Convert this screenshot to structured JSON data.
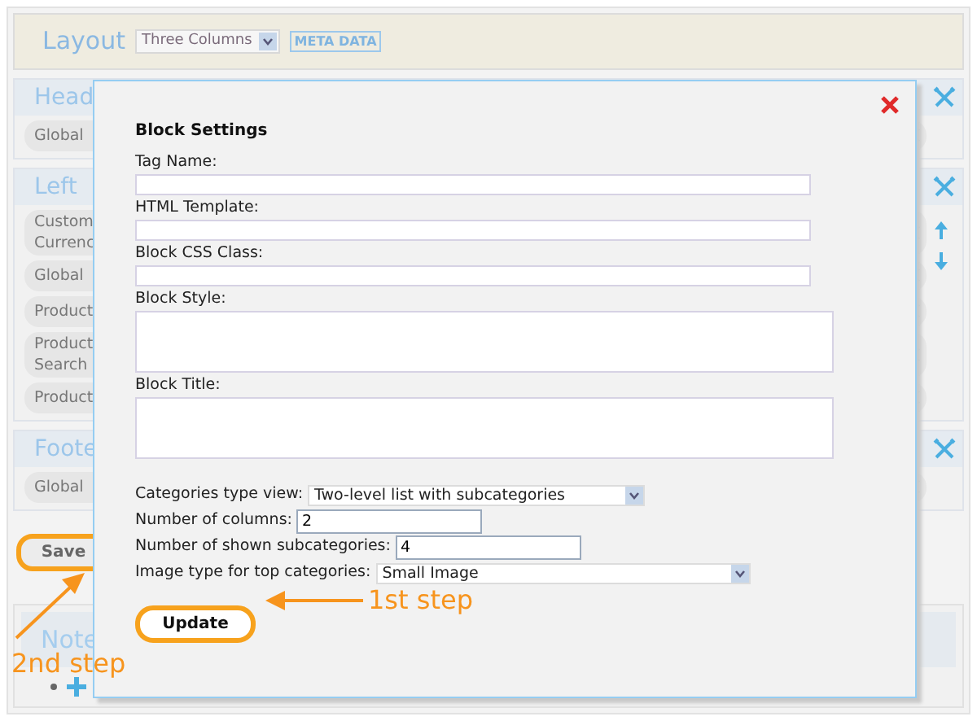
{
  "layout_bar": {
    "label": "Layout",
    "select": "Three Columns",
    "badge": "META DATA"
  },
  "sections": [
    {
      "title": "Head",
      "items": [
        {
          "lines": [
            "Global"
          ]
        }
      ]
    },
    {
      "title": "Left",
      "arrows": true,
      "items": [
        {
          "lines": [
            "Custom",
            "Currenc"
          ]
        },
        {
          "lines": [
            "Global"
          ]
        },
        {
          "lines": [
            "Product"
          ]
        },
        {
          "lines": [
            "Product",
            "Search"
          ]
        },
        {
          "lines": [
            "Product"
          ]
        }
      ]
    },
    {
      "title": "Foote",
      "items": [
        {
          "lines": [
            "Global"
          ]
        }
      ]
    }
  ],
  "save_button": "Save",
  "note": {
    "title": "Note"
  },
  "dialog": {
    "title": "Block Settings",
    "fields": [
      {
        "kind": "input",
        "label": "Tag Name:"
      },
      {
        "kind": "input",
        "label": "HTML Template:"
      },
      {
        "kind": "input",
        "label": "Block CSS Class:"
      },
      {
        "kind": "textarea",
        "label": "Block Style:"
      },
      {
        "kind": "textarea",
        "label": "Block Title:"
      }
    ],
    "options": [
      {
        "kind": "select",
        "label": "Categories type view:",
        "value": "Two-level list with subcategories"
      },
      {
        "kind": "input",
        "label": "Number of columns:",
        "value": "2"
      },
      {
        "kind": "input",
        "label": "Number of shown subcategories:",
        "value": "4"
      },
      {
        "kind": "select",
        "label": "Image type for top categories:",
        "value": "Small Image"
      }
    ],
    "update_button": "Update"
  },
  "annotations": [
    {
      "kind": "update",
      "text": "1st step"
    },
    {
      "kind": "save",
      "text": "2nd step"
    }
  ]
}
